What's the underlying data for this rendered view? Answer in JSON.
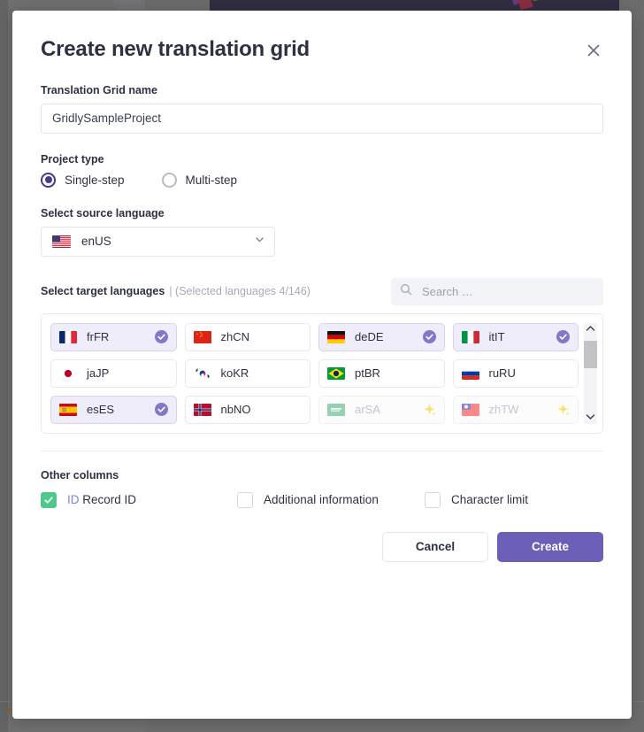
{
  "modal": {
    "title": "Create new translation grid",
    "close_icon": "close-icon"
  },
  "grid_name": {
    "label": "Translation Grid name",
    "value": "GridlySampleProject",
    "placeholder": ""
  },
  "project_type": {
    "label": "Project type",
    "options": [
      {
        "label": "Single-step",
        "selected": true
      },
      {
        "label": "Multi-step",
        "selected": false
      }
    ]
  },
  "source_language": {
    "label": "Select source language",
    "value": "enUS",
    "flag": "flag-us",
    "chevron_icon": "chevron-down-icon"
  },
  "target_languages": {
    "label": "Select target languages",
    "count_text": "| (Selected languages 4/146)",
    "search": {
      "placeholder": "Search …",
      "value": "",
      "icon": "search-icon"
    },
    "items": [
      {
        "code": "frFR",
        "flag": "flag-fr",
        "selected": true,
        "disabled": false
      },
      {
        "code": "zhCN",
        "flag": "flag-cn",
        "selected": false,
        "disabled": false
      },
      {
        "code": "deDE",
        "flag": "flag-de",
        "selected": true,
        "disabled": false
      },
      {
        "code": "itIT",
        "flag": "flag-it",
        "selected": true,
        "disabled": false
      },
      {
        "code": "jaJP",
        "flag": "flag-jp",
        "selected": false,
        "disabled": false
      },
      {
        "code": "koKR",
        "flag": "flag-kr",
        "selected": false,
        "disabled": false
      },
      {
        "code": "ptBR",
        "flag": "flag-br",
        "selected": false,
        "disabled": false
      },
      {
        "code": "ruRU",
        "flag": "flag-ru",
        "selected": false,
        "disabled": false
      },
      {
        "code": "esES",
        "flag": "flag-es",
        "selected": true,
        "disabled": false
      },
      {
        "code": "nbNO",
        "flag": "flag-no",
        "selected": false,
        "disabled": false
      },
      {
        "code": "arSA",
        "flag": "flag-sa",
        "selected": false,
        "disabled": true
      },
      {
        "code": "zhTW",
        "flag": "flag-tw",
        "selected": false,
        "disabled": true
      }
    ],
    "scrollbar": {
      "up_icon": "chevron-up-icon",
      "down_icon": "chevron-down-icon"
    }
  },
  "other_columns": {
    "label": "Other columns",
    "items": [
      {
        "label": "Record ID",
        "prefix": "ID",
        "checked": true
      },
      {
        "label": "Additional information",
        "prefix": "",
        "checked": false
      },
      {
        "label": "Character limit",
        "prefix": "",
        "checked": false
      }
    ]
  },
  "footer": {
    "cancel_label": "Cancel",
    "create_label": "Create"
  },
  "colors": {
    "accent": "#6c5fb8",
    "radio_on": "#443a8e",
    "check_green": "#4ec98a",
    "id_badge": "#7b82f0",
    "chip_selected_bg": "#efedf9",
    "backdrop": "#8a8a8a",
    "app_panel": "#2b2446"
  }
}
